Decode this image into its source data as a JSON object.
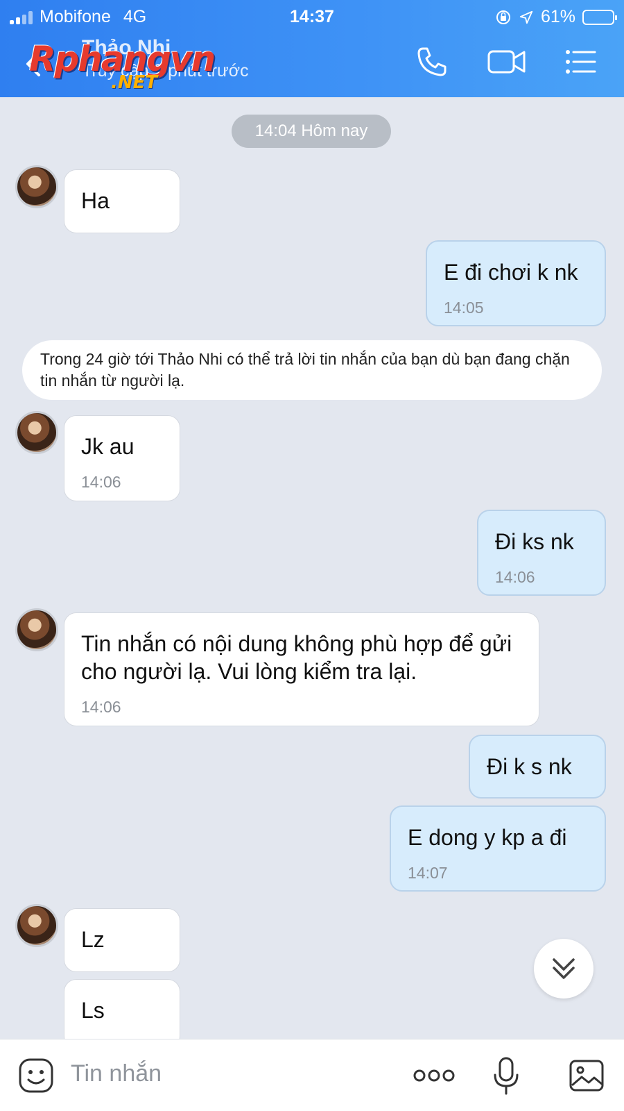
{
  "status_bar": {
    "carrier": "Mobifone",
    "network": "4G",
    "time": "14:37",
    "battery": "61%",
    "battery_level": 0.61,
    "signal_bars": 2
  },
  "header": {
    "contact_name": "Thảo Nhi",
    "contact_status": "Truy cập 9 phút trước",
    "watermark_main": "Rphangvn",
    "watermark_sub": ".NET",
    "icons": [
      "back-icon",
      "phone-icon",
      "video-call-icon",
      "menu-list-icon"
    ]
  },
  "chat": {
    "date_separator": "14:04 Hôm nay",
    "notice": "Trong 24 giờ tới Thảo Nhi có thể trả lời tin nhắn của bạn dù bạn đang chặn tin nhắn từ người lạ.",
    "messages": [
      {
        "from": "them",
        "text": "Ha",
        "time": ""
      },
      {
        "from": "me",
        "text": "E đi chơi k nk",
        "time": "14:05"
      },
      {
        "from": "them",
        "text": "Jk au",
        "time": "14:06"
      },
      {
        "from": "me",
        "text": "Đi ks nk",
        "time": "14:06"
      },
      {
        "from": "them",
        "text": "Tin nhắn có nội dung không phù hợp để gửi cho người lạ. Vui lòng kiểm tra lại.",
        "time": "14:06"
      },
      {
        "from": "me",
        "text": "Đi k s nk",
        "time": ""
      },
      {
        "from": "me",
        "text": "E dong y kp a đi",
        "time": "14:07"
      },
      {
        "from": "them",
        "text": "Lz",
        "time": ""
      },
      {
        "from": "them",
        "text": "Ls",
        "time": ""
      }
    ]
  },
  "input_bar": {
    "placeholder": "Tin nhắn",
    "icons": [
      "emoji-icon",
      "more-icon",
      "microphone-icon",
      "image-icon"
    ]
  },
  "colors": {
    "header": "#3a8cf3",
    "chat_bg": "#e3e7ef",
    "bubble_out": "#d7ecfc",
    "bubble_in": "#ffffff"
  }
}
